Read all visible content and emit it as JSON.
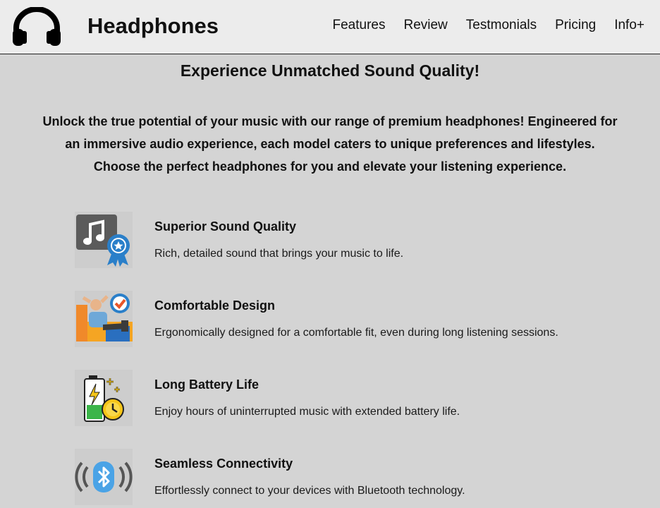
{
  "header": {
    "brand": "Headphones",
    "logo_icon": "headphones-icon",
    "nav": [
      "Features",
      "Review",
      "Testmonials",
      "Pricing",
      "Info+"
    ]
  },
  "hero": {
    "title": "Experience Unmatched Sound Quality!",
    "intro_lines": [
      "Unlock the true potential of your music with our range of premium headphones! Engineered for",
      "an immersive audio experience, each model caters to unique preferences and lifestyles.",
      "Choose the perfect headphones for you and elevate your listening experience."
    ]
  },
  "features": [
    {
      "icon": "music-award-icon",
      "title": "Superior Sound Quality",
      "description": "Rich, detailed sound that brings your music to life."
    },
    {
      "icon": "relaxing-person-icon",
      "title": "Comfortable Design",
      "description": "Ergonomically designed for a comfortable fit, even during long listening sessions."
    },
    {
      "icon": "battery-clock-icon",
      "title": "Long Battery Life",
      "description": "Enjoy hours of uninterrupted music with extended battery life."
    },
    {
      "icon": "bluetooth-icon",
      "title": "Seamless Connectivity",
      "description": "Effortlessly connect to your devices with Bluetooth technology."
    }
  ],
  "colors": {
    "header_bg": "#ececec",
    "page_bg": "#d4d4d4",
    "award_blue": "#2a7fc9",
    "sofa_orange": "#f5a523",
    "battery_green": "#3cb54a",
    "bluetooth_blue": "#4aa3e6"
  }
}
